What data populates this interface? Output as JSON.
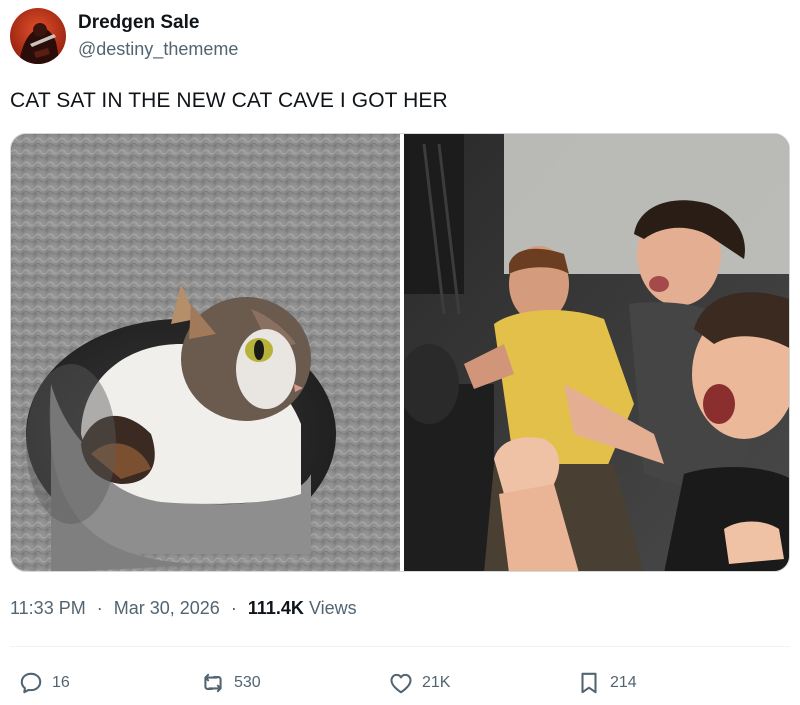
{
  "author": {
    "name": "Dredgen Sale",
    "handle": "@destiny_thememe",
    "avatar_icon": "avatar-image"
  },
  "tweet": {
    "text": "CAT SAT IN THE NEW CAT CAVE I GOT HER"
  },
  "media": [
    {
      "description_icon": "cat-in-cave-photo"
    },
    {
      "description_icon": "reacting-men-photo"
    }
  ],
  "meta": {
    "time": "11:33 PM",
    "separator": "·",
    "date": "Mar 30, 2026",
    "views_count": "111.4K",
    "views_label": "Views"
  },
  "actions": {
    "replies": "16",
    "retweets": "530",
    "likes": "21K",
    "bookmarks": "214"
  },
  "colors": {
    "text_primary": "#0f1419",
    "text_secondary": "#536471",
    "border": "#cfd9de"
  }
}
